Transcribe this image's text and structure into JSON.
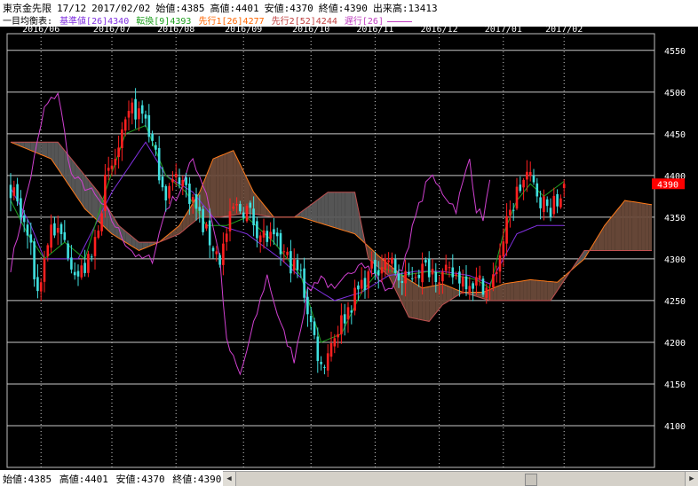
{
  "header": {
    "instrument": "東京金先限",
    "contract": "17/12",
    "date": "2017/02/02",
    "open": "始値:4385",
    "high": "高値:4401",
    "low": "安値:4370",
    "close": "終値:4390",
    "volume": "出来高:13413",
    "legend_prefix": "一目均衡表:",
    "legend_kijun": "基準値[26]4340",
    "legend_tenkan": "転換[9]4393",
    "legend_senkou1": "先行1[26]4277",
    "legend_senkou2": "先行2[52]4244",
    "legend_chikou": "遅行[26]"
  },
  "footer": {
    "open": "始値:4385",
    "high": "高値:4401",
    "low": "安値:4370",
    "close": "終値:4390"
  },
  "colors": {
    "background": "#000000",
    "up": "#ff2020",
    "down": "#40e0e0",
    "kijun": "#8030e0",
    "tenkan": "#20a020",
    "senkou1": "#ff7a1a",
    "senkou2": "#c05050",
    "chikou": "#d040d0",
    "cloud_bull": "#6a4a3a",
    "cloud_bear": "#5a5a5a",
    "last_price": "#ff0000"
  },
  "chart_data": {
    "type": "candlestick",
    "title": "",
    "ylim": [
      4050,
      4570
    ],
    "y_ticks": [
      4100,
      4150,
      4200,
      4250,
      4300,
      4350,
      4400,
      4450,
      4500,
      4550
    ],
    "x_ticks": [
      "2016/06",
      "2016/07",
      "2016/08",
      "2016/09",
      "2016/10",
      "2016/11",
      "2016/12",
      "2017/01",
      "2017/02"
    ],
    "x_tick_index": [
      9,
      30,
      49,
      69,
      89,
      108,
      127,
      146,
      164
    ],
    "grid": true,
    "last_price": 4390,
    "last_price_label": "4390",
    "keypoints": [
      [
        0,
        4385
      ],
      [
        5,
        4330
      ],
      [
        8,
        4260
      ],
      [
        12,
        4340
      ],
      [
        16,
        4320
      ],
      [
        20,
        4280
      ],
      [
        24,
        4300
      ],
      [
        28,
        4390
      ],
      [
        32,
        4430
      ],
      [
        36,
        4480
      ],
      [
        40,
        4470
      ],
      [
        43,
        4420
      ],
      [
        46,
        4380
      ],
      [
        50,
        4400
      ],
      [
        54,
        4370
      ],
      [
        58,
        4330
      ],
      [
        62,
        4300
      ],
      [
        66,
        4360
      ],
      [
        70,
        4360
      ],
      [
        74,
        4330
      ],
      [
        78,
        4320
      ],
      [
        82,
        4300
      ],
      [
        86,
        4280
      ],
      [
        88,
        4240
      ],
      [
        92,
        4170
      ],
      [
        96,
        4210
      ],
      [
        100,
        4240
      ],
      [
        104,
        4270
      ],
      [
        108,
        4290
      ],
      [
        112,
        4300
      ],
      [
        116,
        4270
      ],
      [
        120,
        4285
      ],
      [
        124,
        4290
      ],
      [
        128,
        4280
      ],
      [
        132,
        4280
      ],
      [
        136,
        4275
      ],
      [
        140,
        4270
      ],
      [
        142,
        4260
      ],
      [
        144,
        4290
      ],
      [
        147,
        4340
      ],
      [
        150,
        4380
      ],
      [
        153,
        4400
      ],
      [
        156,
        4380
      ],
      [
        159,
        4360
      ],
      [
        162,
        4365
      ],
      [
        164,
        4390
      ]
    ],
    "kijun_keys": [
      [
        0,
        4385
      ],
      [
        6,
        4340
      ],
      [
        10,
        4300
      ],
      [
        20,
        4300
      ],
      [
        30,
        4380
      ],
      [
        40,
        4440
      ],
      [
        46,
        4400
      ],
      [
        54,
        4380
      ],
      [
        62,
        4340
      ],
      [
        70,
        4330
      ],
      [
        80,
        4300
      ],
      [
        88,
        4270
      ],
      [
        96,
        4250
      ],
      [
        104,
        4260
      ],
      [
        112,
        4280
      ],
      [
        120,
        4285
      ],
      [
        128,
        4285
      ],
      [
        136,
        4280
      ],
      [
        142,
        4270
      ],
      [
        146,
        4300
      ],
      [
        150,
        4330
      ],
      [
        156,
        4340
      ],
      [
        164,
        4340
      ]
    ],
    "tenkan_keys": [
      [
        0,
        4370
      ],
      [
        5,
        4330
      ],
      [
        10,
        4300
      ],
      [
        16,
        4320
      ],
      [
        22,
        4300
      ],
      [
        28,
        4380
      ],
      [
        34,
        4450
      ],
      [
        40,
        4460
      ],
      [
        46,
        4400
      ],
      [
        52,
        4380
      ],
      [
        58,
        4340
      ],
      [
        64,
        4340
      ],
      [
        70,
        4350
      ],
      [
        78,
        4320
      ],
      [
        86,
        4280
      ],
      [
        92,
        4200
      ],
      [
        98,
        4210
      ],
      [
        104,
        4260
      ],
      [
        110,
        4290
      ],
      [
        116,
        4280
      ],
      [
        124,
        4285
      ],
      [
        132,
        4280
      ],
      [
        138,
        4275
      ],
      [
        142,
        4265
      ],
      [
        146,
        4330
      ],
      [
        150,
        4370
      ],
      [
        154,
        4390
      ],
      [
        158,
        4375
      ],
      [
        164,
        4393
      ]
    ],
    "senkou1_keys": [
      [
        0,
        4440
      ],
      [
        12,
        4420
      ],
      [
        22,
        4360
      ],
      [
        30,
        4330
      ],
      [
        38,
        4310
      ],
      [
        44,
        4320
      ],
      [
        50,
        4340
      ],
      [
        56,
        4380
      ],
      [
        60,
        4420
      ],
      [
        66,
        4430
      ],
      [
        72,
        4380
      ],
      [
        78,
        4350
      ],
      [
        86,
        4350
      ],
      [
        94,
        4340
      ],
      [
        102,
        4330
      ],
      [
        110,
        4300
      ],
      [
        116,
        4280
      ],
      [
        122,
        4265
      ],
      [
        128,
        4270
      ],
      [
        134,
        4260
      ],
      [
        140,
        4260
      ],
      [
        146,
        4270
      ],
      [
        154,
        4275
      ],
      [
        162,
        4272
      ],
      [
        170,
        4300
      ],
      [
        176,
        4340
      ],
      [
        182,
        4370
      ],
      [
        190,
        4365
      ]
    ],
    "senkou2_keys": [
      [
        0,
        4440
      ],
      [
        14,
        4440
      ],
      [
        18,
        4420
      ],
      [
        26,
        4380
      ],
      [
        32,
        4340
      ],
      [
        38,
        4320
      ],
      [
        44,
        4320
      ],
      [
        50,
        4330
      ],
      [
        56,
        4350
      ],
      [
        62,
        4350
      ],
      [
        70,
        4355
      ],
      [
        78,
        4350
      ],
      [
        84,
        4350
      ],
      [
        94,
        4380
      ],
      [
        102,
        4380
      ],
      [
        106,
        4300
      ],
      [
        112,
        4280
      ],
      [
        118,
        4230
      ],
      [
        124,
        4225
      ],
      [
        128,
        4245
      ],
      [
        134,
        4260
      ],
      [
        142,
        4250
      ],
      [
        150,
        4250
      ],
      [
        160,
        4250
      ],
      [
        170,
        4310
      ],
      [
        180,
        4310
      ],
      [
        190,
        4310
      ]
    ],
    "chikou_keys": [
      [
        0,
        4290
      ],
      [
        6,
        4400
      ],
      [
        10,
        4480
      ],
      [
        14,
        4500
      ],
      [
        18,
        4400
      ],
      [
        24,
        4380
      ],
      [
        28,
        4360
      ],
      [
        34,
        4320
      ],
      [
        38,
        4300
      ],
      [
        42,
        4300
      ],
      [
        46,
        4360
      ],
      [
        50,
        4380
      ],
      [
        54,
        4420
      ],
      [
        58,
        4380
      ],
      [
        62,
        4300
      ],
      [
        64,
        4200
      ],
      [
        68,
        4160
      ],
      [
        72,
        4220
      ],
      [
        76,
        4280
      ],
      [
        80,
        4220
      ],
      [
        84,
        4180
      ],
      [
        88,
        4260
      ],
      [
        92,
        4280
      ],
      [
        96,
        4260
      ],
      [
        100,
        4280
      ],
      [
        104,
        4300
      ],
      [
        108,
        4280
      ],
      [
        112,
        4260
      ],
      [
        116,
        4290
      ],
      [
        120,
        4350
      ],
      [
        124,
        4400
      ],
      [
        128,
        4380
      ],
      [
        132,
        4360
      ],
      [
        136,
        4420
      ],
      [
        138,
        4360
      ],
      [
        140,
        4350
      ],
      [
        142,
        4390
      ]
    ]
  }
}
